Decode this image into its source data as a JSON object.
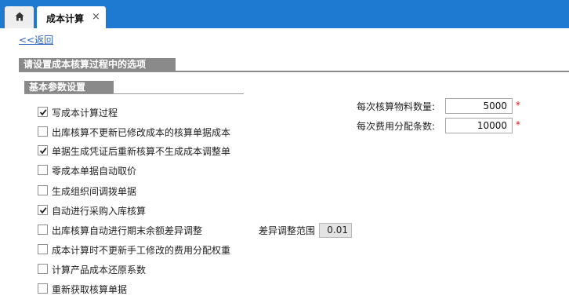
{
  "tabs": {
    "active_label": "成本计算",
    "close_glyph": "×"
  },
  "back_link": "<<返回",
  "section_title": "请设置成本核算过程中的选项",
  "subsection_title": "基本参数设置",
  "options": [
    {
      "label": "写成本计算过程",
      "checked": true
    },
    {
      "label": "出库核算不更新已修改成本的核算单据成本",
      "checked": false
    },
    {
      "label": "单据生成凭证后重新核算不生成成本调整单",
      "checked": true
    },
    {
      "label": "零成本单据自动取价",
      "checked": false
    },
    {
      "label": "生成组织间调拨单据",
      "checked": false
    },
    {
      "label": "自动进行采购入库核算",
      "checked": true
    },
    {
      "label": "出库核算自动进行期末余额差异调整",
      "checked": false
    },
    {
      "label": "成本计算时不更新手工修改的费用分配权重",
      "checked": false
    },
    {
      "label": "计算产品成本还原系数",
      "checked": false
    },
    {
      "label": "重新获取核算单据",
      "checked": false
    }
  ],
  "fields": {
    "material_count_label": "每次核算物料数量:",
    "material_count_value": "5000",
    "fee_count_label": "每次费用分配条数:",
    "fee_count_value": "10000",
    "required_mark": "*",
    "diff_range_label": "差异调整范围",
    "diff_range_value": "0.01"
  },
  "colors": {
    "tab_bar": "#1e7ad0",
    "section_header": "#8a8a8a",
    "link": "#2b62c2",
    "required": "#dd1111"
  }
}
